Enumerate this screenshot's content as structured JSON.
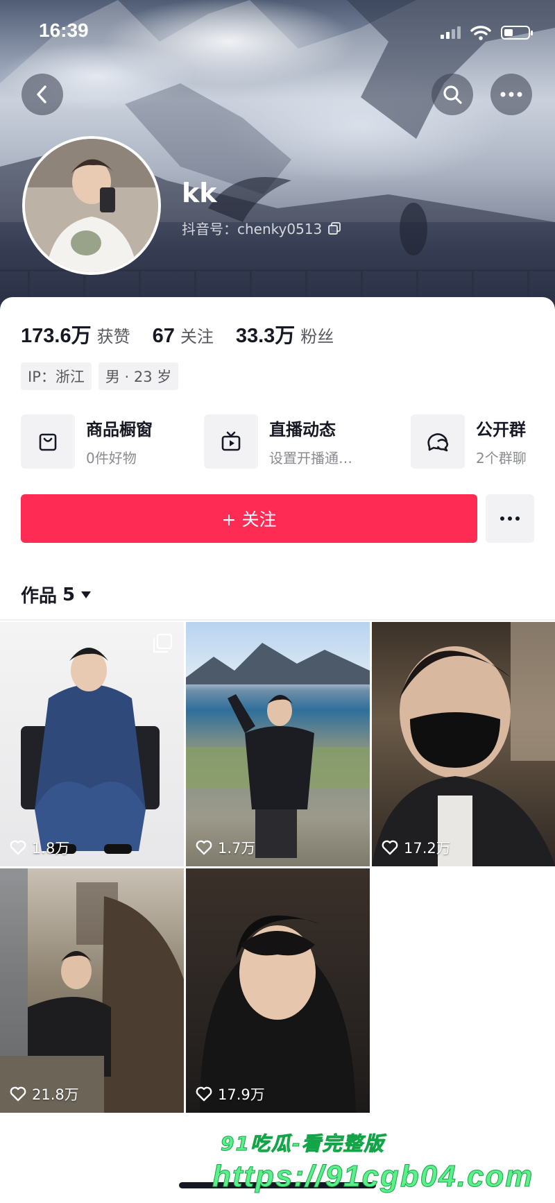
{
  "status_bar": {
    "time": "16:39"
  },
  "header": {
    "back_icon": "chevron-left-icon",
    "search_icon": "search-icon",
    "more_icon": "more-horizontal-icon"
  },
  "profile": {
    "nickname": "kk",
    "douyin_id": "抖音号：chenky0513"
  },
  "stats": [
    {
      "value": "173.6万",
      "label": "获赞"
    },
    {
      "value": "67",
      "label": "关注"
    },
    {
      "value": "33.3万",
      "label": "粉丝"
    }
  ],
  "tags": [
    "IP：浙江",
    "男 · 23 岁"
  ],
  "features": [
    {
      "icon": "shopping-bag-icon",
      "title": "商品橱窗",
      "subtitle": "0件好物"
    },
    {
      "icon": "tv-icon",
      "title": "直播动态",
      "subtitle": "设置开播通…"
    },
    {
      "icon": "chat-bubbles-icon",
      "title": "公开群",
      "subtitle": "2个群聊"
    }
  ],
  "actions": {
    "follow_label": "+ 关注"
  },
  "works_tab": {
    "label": "作品",
    "count": "5"
  },
  "videos": [
    {
      "likes": "1.8万",
      "multi_image": true
    },
    {
      "likes": "1.7万",
      "multi_image": false
    },
    {
      "likes": "17.2万",
      "multi_image": false
    },
    {
      "likes": "21.8万",
      "multi_image": false
    },
    {
      "likes": "17.9万",
      "multi_image": false
    }
  ],
  "watermark": {
    "line1": "91吃瓜-看完整版",
    "line2": "https://91cgb04.com"
  },
  "colors": {
    "accent": "#fe2c55",
    "text": "#161823",
    "muted": "#8a8b91"
  }
}
